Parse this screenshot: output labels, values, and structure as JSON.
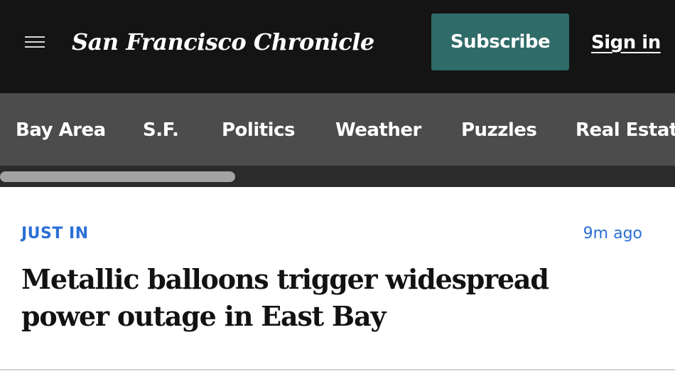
{
  "header": {
    "logo_text": "San Francisco Chronicle",
    "menu_icon": "hamburger-menu-icon",
    "subscribe_label": "Subscribe",
    "signin_label": "Sign in"
  },
  "nav": {
    "items": [
      {
        "label": "Bay Area"
      },
      {
        "label": "S.F."
      },
      {
        "label": "Politics"
      },
      {
        "label": "Weather"
      },
      {
        "label": "Puzzles"
      },
      {
        "label": "Real Estate"
      }
    ]
  },
  "story": {
    "kicker": "JUST IN",
    "timestamp": "9m ago",
    "headline": "Metallic balloons trigger widespread power outage in East Bay"
  },
  "colors": {
    "topbar_bg": "#141414",
    "nav_bg": "#4c4c4c",
    "subscribe_bg": "#2f6b68",
    "kicker_blue": "#2a6fd6"
  }
}
